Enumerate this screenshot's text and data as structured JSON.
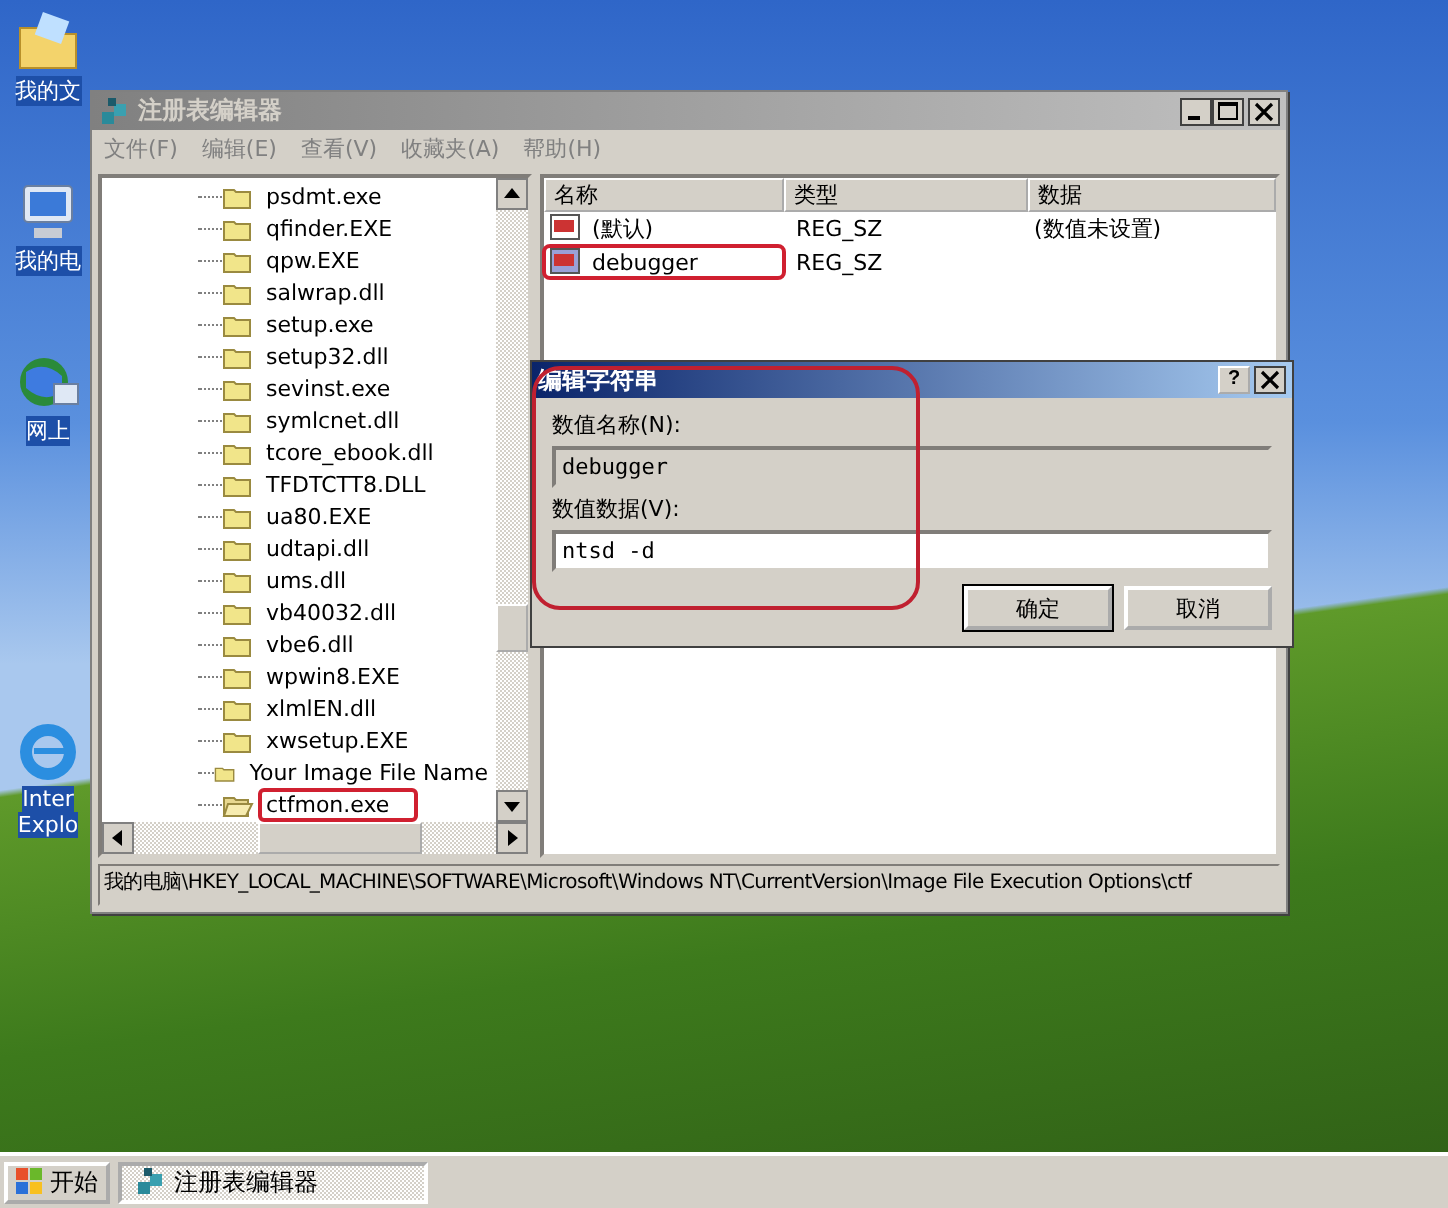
{
  "desktop": {
    "icons": [
      {
        "kind": "folder",
        "lines": [
          "我的文"
        ]
      },
      {
        "kind": "computer",
        "lines": [
          "我的电"
        ]
      },
      {
        "kind": "network",
        "lines": [
          "网上"
        ]
      },
      {
        "kind": "ie",
        "lines": [
          "Inter",
          "Explo"
        ]
      }
    ]
  },
  "window": {
    "title": "注册表编辑器",
    "active": false,
    "menu": [
      "文件(F)",
      "编辑(E)",
      "查看(V)",
      "收藏夹(A)",
      "帮助(H)"
    ],
    "tree": {
      "items": [
        {
          "label": "psdmt.exe",
          "open": false,
          "highlighted": false
        },
        {
          "label": "qfinder.EXE",
          "open": false,
          "highlighted": false
        },
        {
          "label": "qpw.EXE",
          "open": false,
          "highlighted": false
        },
        {
          "label": "salwrap.dll",
          "open": false,
          "highlighted": false
        },
        {
          "label": "setup.exe",
          "open": false,
          "highlighted": false
        },
        {
          "label": "setup32.dll",
          "open": false,
          "highlighted": false
        },
        {
          "label": "sevinst.exe",
          "open": false,
          "highlighted": false
        },
        {
          "label": "symlcnet.dll",
          "open": false,
          "highlighted": false
        },
        {
          "label": "tcore_ebook.dll",
          "open": false,
          "highlighted": false
        },
        {
          "label": "TFDTCTT8.DLL",
          "open": false,
          "highlighted": false
        },
        {
          "label": "ua80.EXE",
          "open": false,
          "highlighted": false
        },
        {
          "label": "udtapi.dll",
          "open": false,
          "highlighted": false
        },
        {
          "label": "ums.dll",
          "open": false,
          "highlighted": false
        },
        {
          "label": "vb40032.dll",
          "open": false,
          "highlighted": false
        },
        {
          "label": "vbe6.dll",
          "open": false,
          "highlighted": false
        },
        {
          "label": "wpwin8.EXE",
          "open": false,
          "highlighted": false
        },
        {
          "label": "xlmlEN.dll",
          "open": false,
          "highlighted": false
        },
        {
          "label": "xwsetup.EXE",
          "open": false,
          "highlighted": false
        },
        {
          "label": "Your Image File Name",
          "open": false,
          "highlighted": false
        },
        {
          "label": "ctfmon.exe",
          "open": true,
          "highlighted": true
        }
      ]
    },
    "list": {
      "columns": [
        "名称",
        "类型",
        "数据"
      ],
      "rows": [
        {
          "kind": "default",
          "name": "(默认)",
          "type": "REG_SZ",
          "data": "(数值未设置)",
          "highlighted": false
        },
        {
          "kind": "value",
          "name": "debugger",
          "type": "REG_SZ",
          "highlighted": true
        }
      ]
    },
    "status_bar": "我的电脑\\HKEY_LOCAL_MACHINE\\SOFTWARE\\Microsoft\\Windows NT\\CurrentVersion\\Image File Execution Options\\ctf"
  },
  "dialog": {
    "title": "编辑字符串",
    "help": "?",
    "highlighted": true,
    "fields": [
      {
        "label": "数值名称(N):",
        "value": "debugger",
        "disabled": true
      },
      {
        "label": "数值数据(V):",
        "value": "ntsd -d",
        "disabled": false
      }
    ],
    "buttons": [
      {
        "label": "确定",
        "default": true
      },
      {
        "label": "取消",
        "default": false
      }
    ]
  },
  "taskbar": {
    "start": "开始",
    "tasks": [
      {
        "label": "注册表编辑器",
        "selected": false
      }
    ]
  }
}
